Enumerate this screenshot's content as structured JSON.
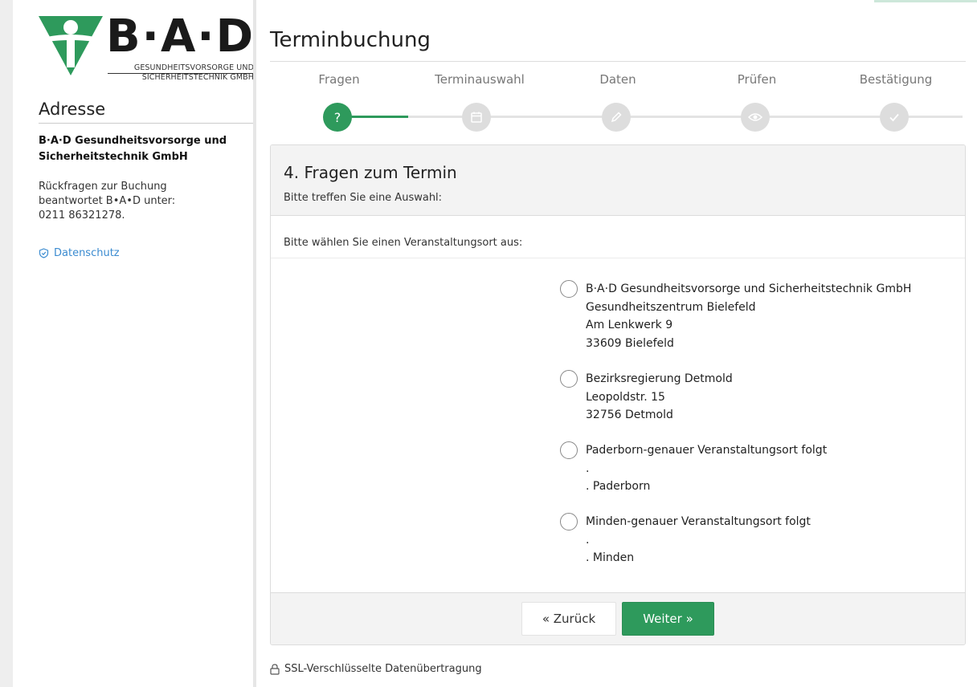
{
  "logo": {
    "wordmark": "B·A·D",
    "subtitle_line1": "GESUNDHEITSVORSORGE UND",
    "subtitle_line2": "SICHERHEITSTECHNIK GMBH"
  },
  "sidebar": {
    "heading": "Adresse",
    "company": "B·A·D Gesundheitsvorsorge und Sicherheitstechnik GmbH",
    "info_line1": "Rückfragen zur Buchung",
    "info_line2": "beantwortet B•A•D unter:",
    "info_line3": "0211 86321278.",
    "privacy_label": "Datenschutz"
  },
  "page": {
    "title": "Terminbuchung"
  },
  "steps": [
    {
      "label": "Fragen",
      "icon": "question-icon",
      "symbol": "?"
    },
    {
      "label": "Terminauswahl",
      "icon": "calendar-icon"
    },
    {
      "label": "Daten",
      "icon": "pencil-icon"
    },
    {
      "label": "Prüfen",
      "icon": "eye-icon"
    },
    {
      "label": "Bestätigung",
      "icon": "check-icon"
    }
  ],
  "current_step": 1,
  "card": {
    "title": "4. Fragen zum Termin",
    "subtitle": "Bitte treffen Sie eine Auswahl:",
    "question": "Bitte wählen Sie einen Veranstaltungsort aus:",
    "options": [
      {
        "lines": [
          "B·A·D Gesundheitsvorsorge und Sicherheitstechnik GmbH",
          "Gesundheitszentrum Bielefeld",
          "Am Lenkwerk 9",
          "33609 Bielefeld"
        ]
      },
      {
        "lines": [
          "Bezirksregierung Detmold",
          "Leopoldstr. 15",
          "32756 Detmold"
        ]
      },
      {
        "lines": [
          "Paderborn-genauer Veranstaltungsort folgt",
          ".",
          ". Paderborn"
        ]
      },
      {
        "lines": [
          "Minden-genauer Veranstaltungsort folgt",
          ".",
          ". Minden"
        ]
      }
    ],
    "back_label": "« Zurück",
    "next_label": "Weiter »"
  },
  "footer": {
    "ssl_label": "SSL-Verschlüsselte Datenübertragung"
  },
  "colors": {
    "accent": "#2e9a5c",
    "link": "#3b8bd0",
    "inactive_step": "#dddddd"
  }
}
